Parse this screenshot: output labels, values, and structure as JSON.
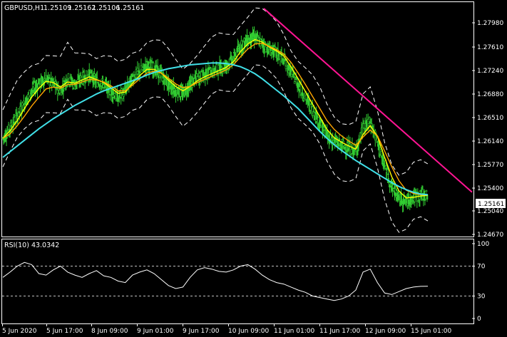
{
  "header": {
    "symbol": "GBPUSD,H1",
    "open": "1.25109",
    "high": "1.25162",
    "low": "1.25106",
    "close": "1.25161"
  },
  "price_axis": {
    "labels": [
      "1.27980",
      "1.27610",
      "1.27240",
      "1.26880",
      "1.26510",
      "1.26140",
      "1.25770",
      "1.25400",
      "1.25040",
      "1.24670"
    ],
    "current_price": "1.25161",
    "current_price_color": "#ffffff"
  },
  "indicator_panel": {
    "title": "RSI(10) 43.0342",
    "levels": [
      "100",
      "70",
      "30",
      "0"
    ],
    "levels_num": [
      100,
      70,
      30,
      0
    ],
    "level_line_color": "#ffffff"
  },
  "time_axis": {
    "labels": [
      "5 Jun 2020",
      "5 Jun 17:00",
      "8 Jun 09:00",
      "9 Jun 01:00",
      "9 Jun 17:00",
      "10 Jun 09:00",
      "11 Jun 01:00",
      "11 Jun 17:00",
      "12 Jun 09:00",
      "15 Jun 01:00"
    ]
  },
  "colors": {
    "background": "#000000",
    "candles": "#32cd32",
    "ma_fast": "#ffff00",
    "ma_mid": "#ffa500",
    "ma_slow": "#40e0e8",
    "envelope": "#ffffff",
    "trendline": "#ff1493",
    "rsi_line": "#ffffff"
  },
  "chart_data": {
    "type": "line",
    "title": "GBPUSD,H1",
    "ylim": [
      1.245,
      1.282
    ],
    "price_path": [
      1.2605,
      1.262,
      1.264,
      1.266,
      1.268,
      1.269,
      1.27,
      1.269,
      1.268,
      1.27,
      1.269,
      1.27,
      1.2705,
      1.2695,
      1.269,
      1.268,
      1.267,
      1.268,
      1.27,
      1.271,
      1.272,
      1.2715,
      1.2705,
      1.269,
      1.268,
      1.2675,
      1.269,
      1.27,
      1.2705,
      1.271,
      1.2715,
      1.272,
      1.273,
      1.275,
      1.276,
      1.2765,
      1.2755,
      1.2745,
      1.274,
      1.273,
      1.271,
      1.269,
      1.267,
      1.265,
      1.263,
      1.261,
      1.26,
      1.2595,
      1.259,
      1.2585,
      1.262,
      1.263,
      1.26,
      1.256,
      1.253,
      1.251,
      1.2505,
      1.2512,
      1.2515,
      1.2516
    ],
    "series": [
      {
        "values": [
          1.2605,
          1.2617,
          1.2633,
          1.2652,
          1.267,
          1.2684,
          1.2695,
          1.2693,
          1.2686,
          1.2694,
          1.2692,
          1.2697,
          1.2702,
          1.2698,
          1.2693,
          1.2685,
          1.2676,
          1.2678,
          1.2692,
          1.2704,
          1.2714,
          1.2714,
          1.2708,
          1.2697,
          1.2687,
          1.268,
          1.2687,
          1.2696,
          1.2702,
          1.2707,
          1.2712,
          1.2717,
          1.2726,
          1.2742,
          1.2754,
          1.2761,
          1.2757,
          1.2749,
          1.2743,
          1.2735,
          1.2718,
          1.2699,
          1.2679,
          1.2659,
          1.2639,
          1.2619,
          1.2606,
          1.2599,
          1.2593,
          1.2588,
          1.2611,
          1.2625,
          1.2608,
          1.2575,
          1.2544,
          1.2522,
          1.2511,
          1.2512,
          1.2514,
          1.2515
        ]
      },
      {
        "values": [
          1.2605,
          1.2612,
          1.2625,
          1.264,
          1.2656,
          1.267,
          1.2683,
          1.2686,
          1.2684,
          1.269,
          1.269,
          1.2694,
          1.2698,
          1.2697,
          1.2694,
          1.2688,
          1.268,
          1.268,
          1.2689,
          1.2699,
          1.2708,
          1.2711,
          1.2708,
          1.27,
          1.2691,
          1.2685,
          1.2687,
          1.2693,
          1.2698,
          1.2703,
          1.2708,
          1.2713,
          1.2721,
          1.2734,
          1.2746,
          1.2754,
          1.2755,
          1.275,
          1.2745,
          1.2738,
          1.2725,
          1.2708,
          1.269,
          1.2671,
          1.2652,
          1.2633,
          1.2619,
          1.2609,
          1.2601,
          1.2594,
          1.2607,
          1.2618,
          1.2609,
          1.2585,
          1.256,
          1.2538,
          1.2523,
          1.2518,
          1.2516,
          1.2516
        ]
      },
      {
        "values": [
          1.2575,
          1.2584,
          1.2593,
          1.2602,
          1.2611,
          1.262,
          1.2628,
          1.2636,
          1.2643,
          1.265,
          1.2657,
          1.2663,
          1.2669,
          1.2675,
          1.268,
          1.2684,
          1.2688,
          1.2692,
          1.2696,
          1.27,
          1.2705,
          1.2709,
          1.2712,
          1.2715,
          1.2717,
          1.2719,
          1.2721,
          1.2722,
          1.2723,
          1.2724,
          1.2724,
          1.2723,
          1.2721,
          1.2718,
          1.2713,
          1.2707,
          1.2699,
          1.269,
          1.2681,
          1.2672,
          1.2662,
          1.2652,
          1.264,
          1.2628,
          1.2616,
          1.2605,
          1.2595,
          1.2586,
          1.2578,
          1.257,
          1.2563,
          1.2556,
          1.2549,
          1.2542,
          1.2535,
          1.2529,
          1.2524,
          1.252,
          1.2517,
          1.2516
        ]
      }
    ],
    "trendline": {
      "from": [
        1.281
      ],
      "to": [
        1.252
      ]
    },
    "rsi": [
      55,
      62,
      70,
      75,
      72,
      60,
      58,
      65,
      70,
      62,
      58,
      55,
      60,
      64,
      57,
      55,
      50,
      48,
      58,
      62,
      65,
      60,
      52,
      44,
      40,
      42,
      55,
      65,
      68,
      66,
      63,
      62,
      65,
      70,
      72,
      66,
      58,
      52,
      48,
      46,
      42,
      38,
      35,
      30,
      28,
      26,
      24,
      26,
      30,
      38,
      62,
      66,
      48,
      34,
      32,
      36,
      40,
      42,
      43,
      43.0342
    ]
  }
}
